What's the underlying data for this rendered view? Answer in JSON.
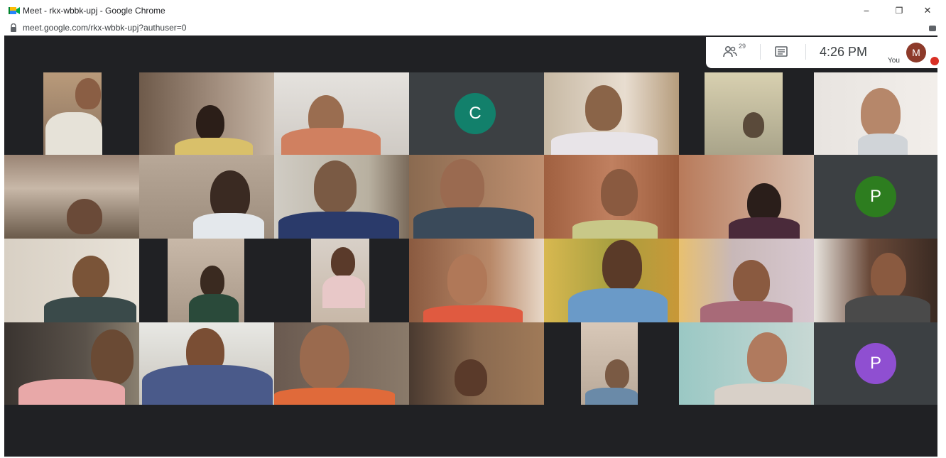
{
  "window": {
    "title": "Meet - rkx-wbbk-upj - Google Chrome",
    "url": "meet.google.com/rkx-wbbk-upj?authuser=0",
    "minimize": "−",
    "restore": "❐",
    "close": "✕"
  },
  "topbar": {
    "participant_count": "29",
    "time": "4:26 PM",
    "you_label": "You",
    "avatar_initial": "M",
    "people_icon": "people-icon",
    "chat_icon": "chat-icon"
  },
  "tiles": {
    "c": {
      "initial": "C",
      "color": "#12806b"
    },
    "p1": {
      "initial": "P",
      "color": "#2d7d1f"
    },
    "p2": {
      "initial": "P",
      "color": "#8f4fd1"
    }
  },
  "colors": {
    "meet_background": "#202124",
    "avatar_m": "#8d3a2a",
    "notification": "#d93025"
  }
}
